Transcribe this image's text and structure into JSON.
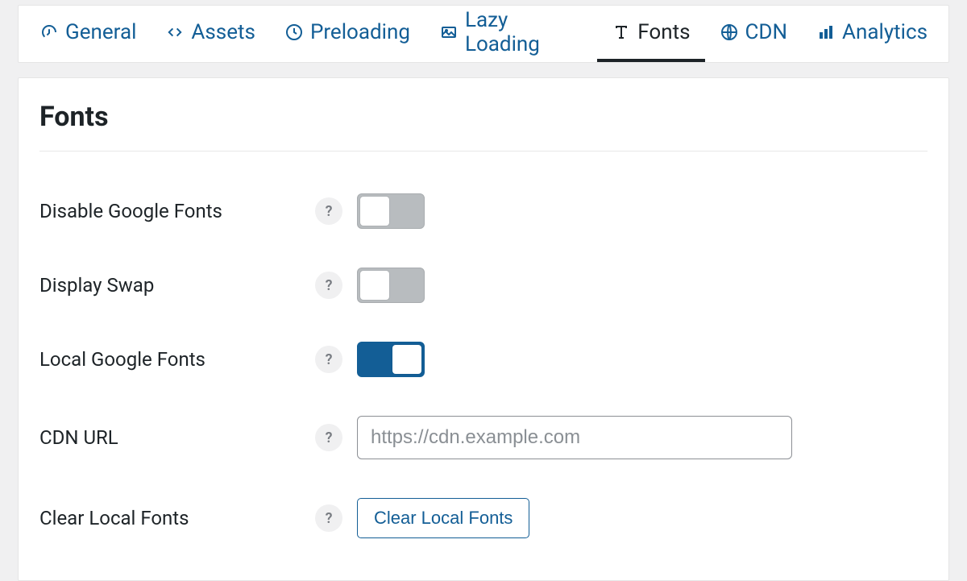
{
  "tabs": [
    {
      "id": "general",
      "label": "General",
      "icon": "gauge"
    },
    {
      "id": "assets",
      "label": "Assets",
      "icon": "code"
    },
    {
      "id": "preloading",
      "label": "Preloading",
      "icon": "clock"
    },
    {
      "id": "lazyloading",
      "label": "Lazy Loading",
      "icon": "images"
    },
    {
      "id": "fonts",
      "label": "Fonts",
      "icon": "font",
      "active": true
    },
    {
      "id": "cdn",
      "label": "CDN",
      "icon": "globe"
    },
    {
      "id": "analytics",
      "label": "Analytics",
      "icon": "bars"
    }
  ],
  "panel": {
    "title": "Fonts",
    "rows": {
      "disableGoogleFonts": {
        "label": "Disable Google Fonts",
        "help": "?",
        "toggle": false
      },
      "displaySwap": {
        "label": "Display Swap",
        "help": "?",
        "toggle": false
      },
      "localGoogleFonts": {
        "label": "Local Google Fonts",
        "help": "?",
        "toggle": true
      },
      "cdnUrl": {
        "label": "CDN URL",
        "help": "?",
        "placeholder": "https://cdn.example.com",
        "value": ""
      },
      "clearLocalFonts": {
        "label": "Clear Local Fonts",
        "help": "?",
        "button": "Clear Local Fonts"
      }
    }
  }
}
